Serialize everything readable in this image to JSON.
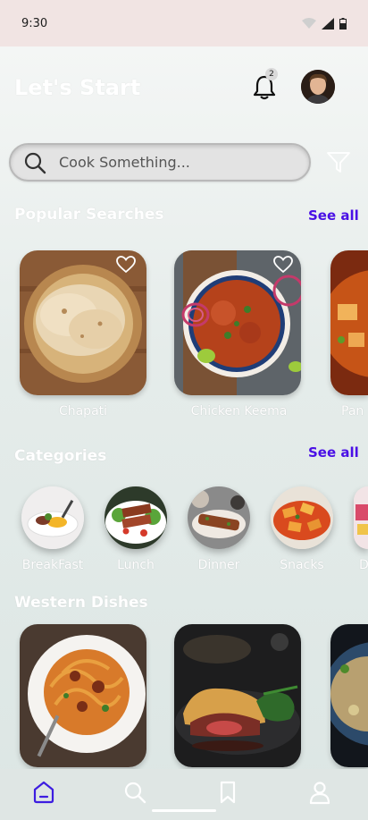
{
  "status": {
    "time": "9:30"
  },
  "header": {
    "title": "Let's Start",
    "notification_count": "2"
  },
  "search": {
    "placeholder": "Cook Something..."
  },
  "popular": {
    "title": "Popular Searches",
    "see_all": "See all",
    "items": [
      {
        "label": "Chapati"
      },
      {
        "label": "Chicken Keema"
      },
      {
        "label": "Pan"
      }
    ]
  },
  "categories": {
    "title": "Categories",
    "see_all": "See all",
    "items": [
      {
        "label": "BreakFast"
      },
      {
        "label": "Lunch"
      },
      {
        "label": "Dinner"
      },
      {
        "label": "Snacks"
      },
      {
        "label": "D"
      }
    ]
  },
  "western": {
    "title": "Western Dishes"
  },
  "nav": {
    "items": [
      "home-icon",
      "search-icon",
      "bookmark-icon",
      "profile-icon"
    ],
    "active_color": "#3d1de0"
  },
  "colors": {
    "accent": "#4a10e6"
  }
}
